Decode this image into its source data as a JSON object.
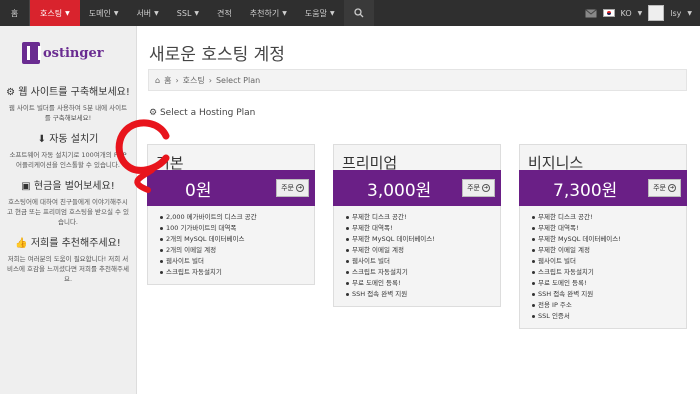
{
  "nav": {
    "home_label": "홈",
    "items": [
      {
        "label": "호스팅",
        "active": true
      },
      {
        "label": "도메인",
        "active": false
      },
      {
        "label": "서버",
        "active": false
      },
      {
        "label": "SSL",
        "active": false
      },
      {
        "label": "견적",
        "active": false
      },
      {
        "label": "추천하기",
        "active": false
      },
      {
        "label": "도움말",
        "active": false
      }
    ],
    "lang": "KO",
    "user": "lsy"
  },
  "sidebar": {
    "logo_text": "ostinger",
    "sections": [
      {
        "icon": "gears-icon",
        "heading": "웹 사이트를 구축해보세요!",
        "text": "웹 사이트 빌더를 사용하여 5분 내에 사이트를 구축해보세요!"
      },
      {
        "icon": "download-icon",
        "heading": "자동 설치기",
        "text": "소프트웨어 자동 설치기로 100여개의 PHP 어플리케이션을 인스톨할 수 있습니다."
      },
      {
        "icon": "money-icon",
        "heading": "현금을 벌어보세요!",
        "text": "호스팅어에 대하여 친구들에게 이야기해주시고 현금 또는 프리미엄 호스팅을 받으실 수 있습니다."
      },
      {
        "icon": "thumbs-up-icon",
        "heading": "저희를 추천해주세요!",
        "text": "저희는 여러분의 도움이 필요합니다! 저희 서비스에 호감을 느끼셨다면 저희를 추천해주세요."
      }
    ]
  },
  "main": {
    "title": "새로운 호스팅 계정",
    "breadcrumb": [
      "홈",
      "호스팅",
      "Select Plan"
    ],
    "section_heading": "Select a Hosting Plan",
    "order_label": "주문",
    "plans": [
      {
        "name": "기본",
        "price": "0원",
        "features": [
          "2,000 메가바이트의 디스크 공간",
          "100 기가바이트의 대역폭",
          "2개의 MySQL 데이터베이스",
          "2개의 이메일 계정",
          "웹사이트 빌더",
          "스크립트 자동설치기"
        ]
      },
      {
        "name": "프리미엄",
        "price": "3,000원",
        "features": [
          "무제한 디스크 공간!",
          "무제한 대역폭!",
          "무제한 MySQL 데이터베이스!",
          "무제한 이메일 계정",
          "웹사이트 빌더",
          "스크립트 자동설치기",
          "무료 도메인 등록!",
          "SSH 접속 완벽 지원"
        ]
      },
      {
        "name": "비지니스",
        "price": "7,300원",
        "features": [
          "무제한 디스크 공간!",
          "무제한 대역폭!",
          "무제한 MySQL 데이터베이스!",
          "무제한 이메일 계정",
          "웹사이트 빌더",
          "스크립트 자동설치기",
          "무료 도메인 등록!",
          "SSH 접속 완벽 지원",
          "전용 IP 주소",
          "SSL 인증서"
        ]
      }
    ]
  }
}
